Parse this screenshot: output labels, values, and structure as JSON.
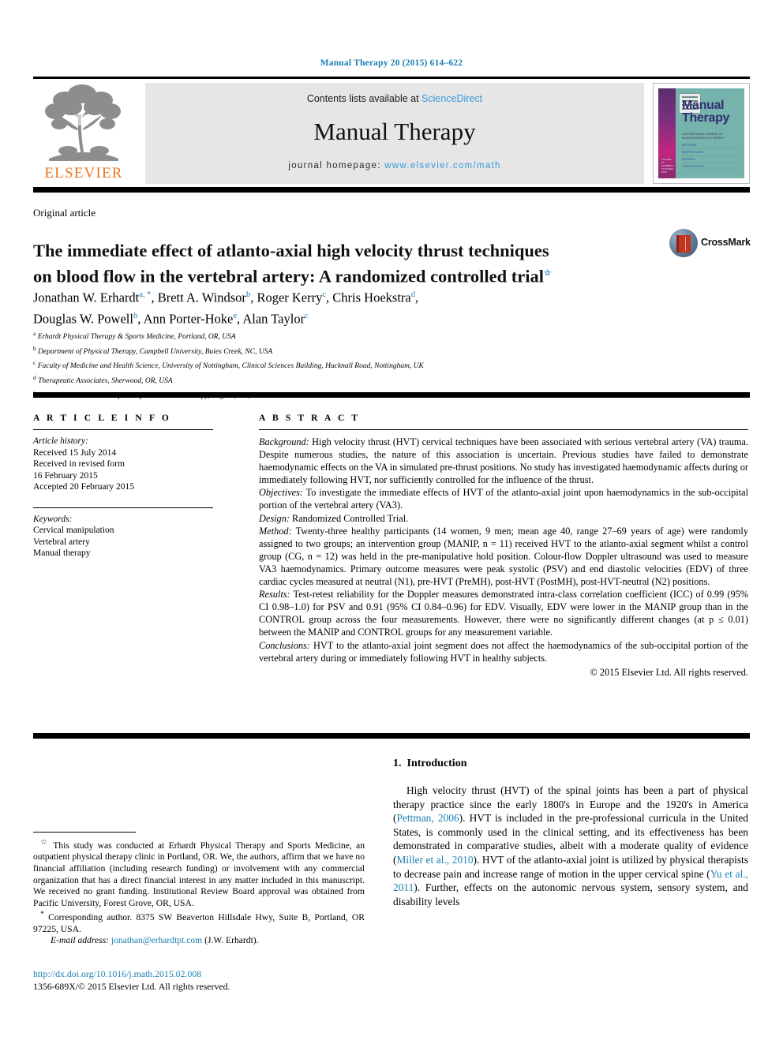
{
  "running_head": "Manual Therapy 20 (2015) 614–622",
  "masthead": {
    "publisher_wordmark": "ELSEVIER",
    "contents_prefix": "Contents lists available at ",
    "contents_link": "ScienceDirect",
    "journal_name": "Manual Therapy",
    "homepage_prefix": "journal homepage: ",
    "homepage_url": "www.elsevier.com/math"
  },
  "cover": {
    "title_line1": "Manual",
    "title_line2": "Therapy",
    "subtitle": "INTERNATIONAL JOURNAL OF\nMUSCULOSKELETAL THERAPY",
    "toc_lines": [
      "EDITORIAL",
      "MASTERCLASS",
      "REVIEWS",
      "CASE REPORTS"
    ],
    "spine_text": "VOLUME 20\nNUMBER 5\nOCTOBER 2015"
  },
  "article": {
    "type": "Original article",
    "title_line1": "The immediate effect of atlanto-axial high velocity thrust techniques",
    "title_line2": "on blood flow in the vertebral artery: A randomized controlled trial",
    "title_marker": "☆",
    "crossmark_label": "CrossMark",
    "authors": [
      {
        "name": "Jonathan W. Erhardt",
        "marks": "a, *",
        "sep": ", "
      },
      {
        "name": "Brett A. Windsor",
        "marks": "b",
        "sep": ", "
      },
      {
        "name": "Roger Kerry",
        "marks": "c",
        "sep": ", "
      },
      {
        "name": "Chris Hoekstra",
        "marks": "d",
        "sep": ","
      },
      {
        "name": "Douglas W. Powell",
        "marks": "b",
        "sep": ", "
      },
      {
        "name": "Ann Porter-Hoke",
        "marks": "e",
        "sep": ", "
      },
      {
        "name": "Alan Taylor",
        "marks": "c",
        "sep": ""
      }
    ],
    "affiliations": [
      {
        "mark": "a",
        "text": "Erhardt Physical Therapy & Sports Medicine, Portland, OR, USA"
      },
      {
        "mark": "b",
        "text": "Department of Physical Therapy, Campbell University, Buies Creek, NC, USA"
      },
      {
        "mark": "c",
        "text": "Faculty of Medicine and Health Science, University of Nottingham, Clinical Sciences Building, Hucknall Road, Nottingham, UK"
      },
      {
        "mark": "d",
        "text": "Therapeutic Associates, Sherwood, OR, USA"
      },
      {
        "mark": "e",
        "text": "North American Institute of Orthopedic Manual Therapy, Eugene, OR, USA"
      }
    ]
  },
  "article_info": {
    "heading": "A R T I C L E  I N F O",
    "history_label": "Article history:",
    "history_lines": [
      "Received 15 July 2014",
      "Received in revised form",
      "16 February 2015",
      "Accepted 20 February 2015"
    ],
    "keywords_label": "Keywords:",
    "keywords": [
      "Cervical manipulation",
      "Vertebral artery",
      "Manual therapy"
    ]
  },
  "abstract": {
    "heading": "A B S T R A C T",
    "sections": [
      {
        "label": "Background:",
        "text": " High velocity thrust (HVT) cervical techniques have been associated with serious vertebral artery (VA) trauma. Despite numerous studies, the nature of this association is uncertain. Previous studies have failed to demonstrate haemodynamic effects on the VA in simulated pre-thrust positions. No study has investigated haemodynamic affects during or immediately following HVT, nor sufficiently controlled for the influence of the thrust."
      },
      {
        "label": "Objectives:",
        "text": " To investigate the immediate effects of HVT of the atlanto-axial joint upon haemodynamics in the sub-occipital portion of the vertebral artery (VA3)."
      },
      {
        "label": "Design:",
        "text": " Randomized Controlled Trial."
      },
      {
        "label": "Method:",
        "text": " Twenty-three healthy participants (14 women, 9 men; mean age 40, range 27–69 years of age) were randomly assigned to two groups; an intervention group (MANIP, n = 11) received HVT to the atlanto-axial segment whilst a control group (CG, n = 12) was held in the pre-manipulative hold position. Colour-flow Doppler ultrasound was used to measure VA3 haemodynamics. Primary outcome measures were peak systolic (PSV) and end diastolic velocities (EDV) of three cardiac cycles measured at neutral (N1), pre-HVT (PreMH), post-HVT (PostMH), post-HVT-neutral (N2) positions."
      },
      {
        "label": "Results:",
        "text": " Test-retest reliability for the Doppler measures demonstrated intra-class correlation coefficient (ICC) of 0.99 (95% CI 0.98–1.0) for PSV and 0.91 (95% CI 0.84–0.96) for EDV. Visually, EDV were lower in the MANIP group than in the CONTROL group across the four measurements. However, there were no significantly different changes (at p ≤ 0.01) between the MANIP and CONTROL groups for any measurement variable."
      },
      {
        "label": "Conclusions:",
        "text": " HVT to the atlanto-axial joint segment does not affect the haemodynamics of the sub-occipital portion of the vertebral artery during or immediately following HVT in healthy subjects."
      }
    ],
    "copyright": "© 2015 Elsevier Ltd. All rights reserved."
  },
  "footnotes": {
    "star_note": "This study was conducted at Erhardt Physical Therapy and Sports Medicine, an outpatient physical therapy clinic in Portland, OR. We, the authors, affirm that we have no financial affiliation (including research funding) or involvement with any commercial organization that has a direct financial interest in any matter included in this manuscript. We received no grant funding. Institutional Review Board approval was obtained from Pacific University, Forest Grove, OR, USA.",
    "star_marker": "☆",
    "corresponding_marker": "*",
    "corresponding_note": "Corresponding author. 8375 SW Beaverton Hillsdale Hwy, Suite B, Portland, OR 97225, USA.",
    "email_label": "E-mail address:",
    "email_address": "jonathan@erhardtpt.com",
    "email_owner": "(J.W. Erhardt).",
    "doi_url": "http://dx.doi.org/10.1016/j.math.2015.02.008",
    "issn_line": "1356-689X/© 2015 Elsevier Ltd. All rights reserved."
  },
  "introduction": {
    "number": "1.",
    "heading": "Introduction",
    "paragraph_parts": [
      {
        "t": "High velocity thrust (HVT) of the spinal joints has been a part of physical therapy practice since the early 1800's in Europe and the 1920's in America (",
        "k": "text"
      },
      {
        "t": "Pettman, 2006",
        "k": "cite"
      },
      {
        "t": "). HVT is included in the pre-professional curricula in the United States, is commonly used in the clinical setting, and its effectiveness has been demonstrated in comparative studies, albeit with a moderate quality of evidence (",
        "k": "text"
      },
      {
        "t": "Miller et al., 2010",
        "k": "cite"
      },
      {
        "t": "). HVT of the atlanto-axial joint is utilized by physical therapists to decrease pain and increase range of motion in the upper cervical spine (",
        "k": "text"
      },
      {
        "t": "Yu et al., 2011",
        "k": "cite"
      },
      {
        "t": "). Further, effects on the autonomic nervous system, sensory system, and disability levels",
        "k": "text"
      }
    ]
  },
  "colors": {
    "link": "#1a7fb5",
    "elsevier_orange": "#e87722",
    "banner_bg": "#e6e6e6",
    "cover_teal": "#77b3ad",
    "cover_magenta": "#c0267f"
  }
}
